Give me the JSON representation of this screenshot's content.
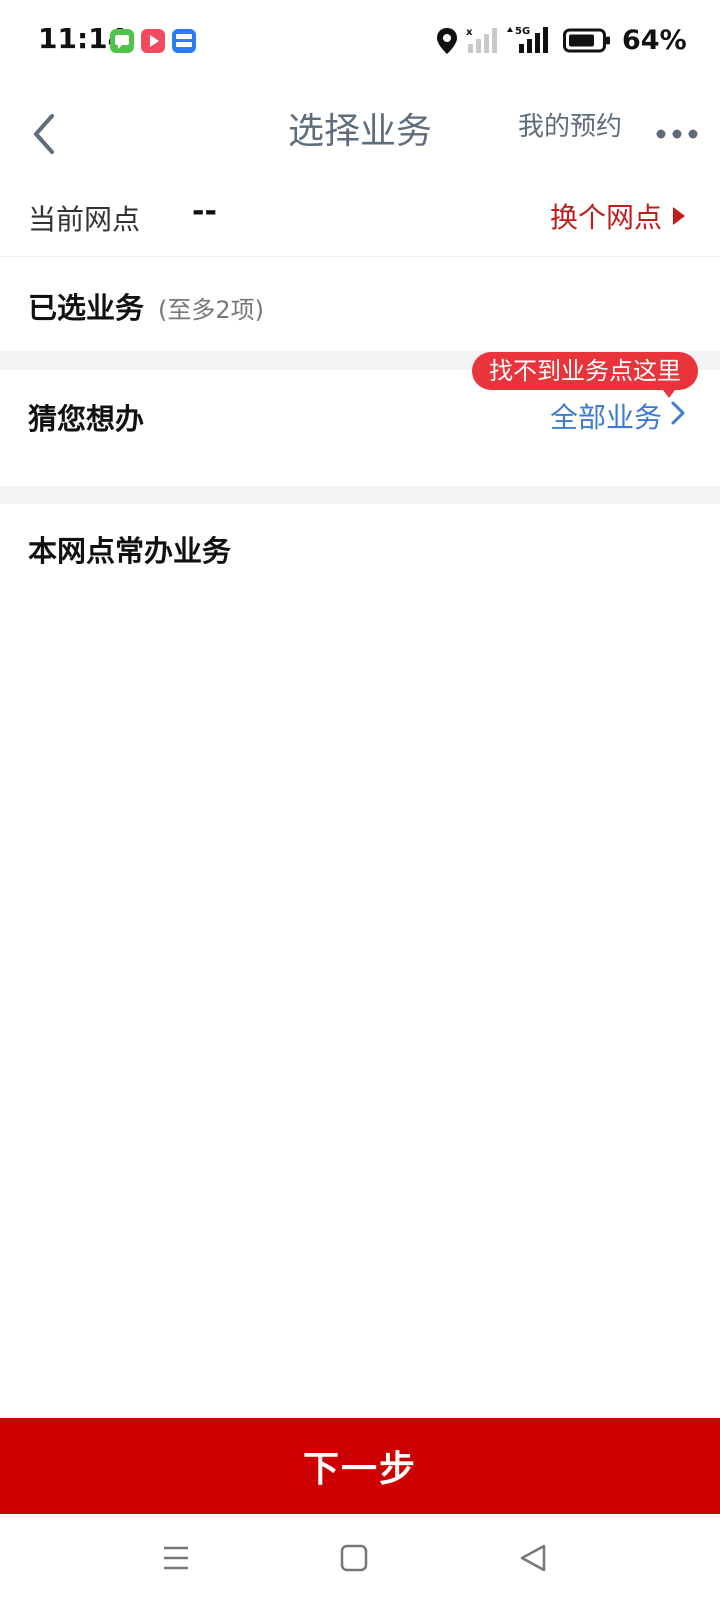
{
  "status_bar": {
    "time": "11:14",
    "battery_percent": "64%",
    "network_label": "5G",
    "app_icons": [
      "message-app-icon",
      "video-app-icon",
      "yupao-app-icon"
    ]
  },
  "nav": {
    "title": "选择业务",
    "my_appointments": "我的预约"
  },
  "branch": {
    "label": "当前网点",
    "value": "--",
    "change_label": "换个网点"
  },
  "selected": {
    "label": "已选业务",
    "hint": "(至多2项)"
  },
  "guess": {
    "label": "猜您想办",
    "tooltip": "找不到业务点这里",
    "all_link": "全部业务"
  },
  "common": {
    "label": "本网点常办业务"
  },
  "next_button": "下一步",
  "colors": {
    "accent_red": "#cc0000",
    "link_blue": "#3d7ad1",
    "tooltip_red": "#e8343a",
    "title_gray": "#5e6d7c"
  }
}
